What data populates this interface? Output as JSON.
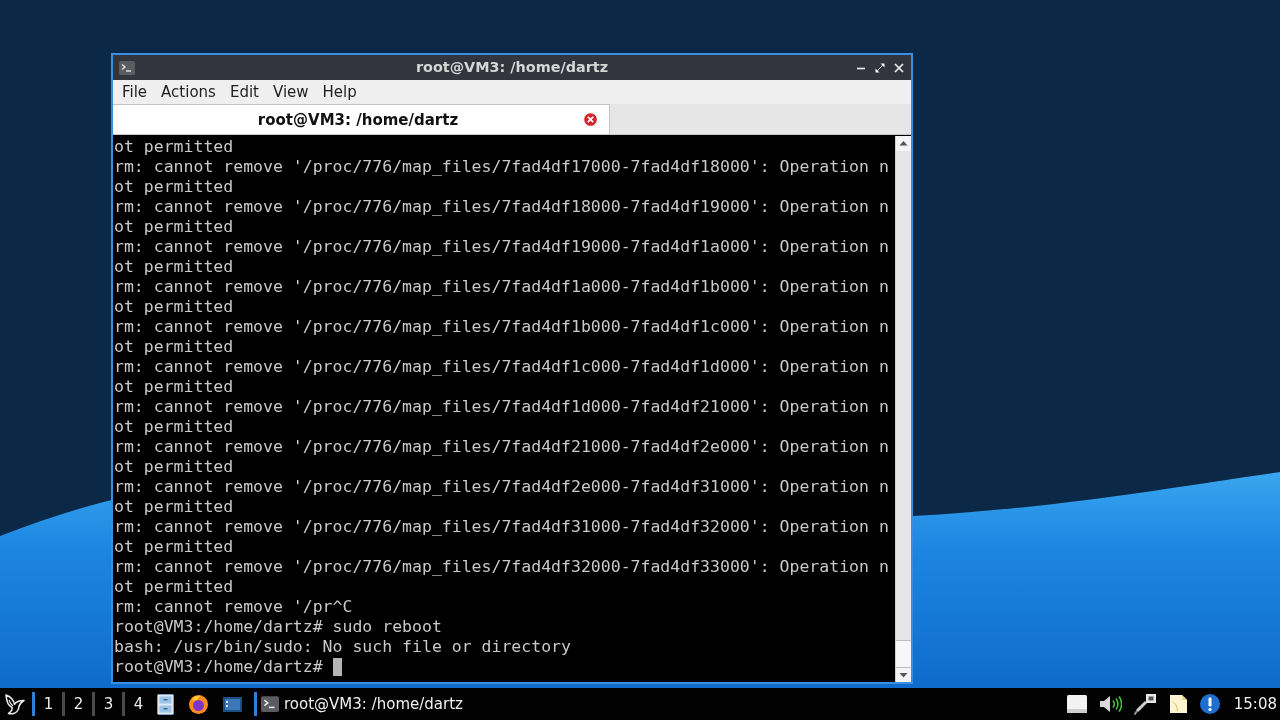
{
  "window": {
    "title": "root@VM3: /home/dartz"
  },
  "menu": [
    "File",
    "Actions",
    "Edit",
    "View",
    "Help"
  ],
  "tabs": [
    {
      "label": "root@VM3: /home/dartz",
      "selected": true
    }
  ],
  "terminal": {
    "lines": [
      "ot permitted",
      "rm: cannot remove '/proc/776/map_files/7fad4df17000-7fad4df18000': Operation n",
      "ot permitted",
      "rm: cannot remove '/proc/776/map_files/7fad4df18000-7fad4df19000': Operation n",
      "ot permitted",
      "rm: cannot remove '/proc/776/map_files/7fad4df19000-7fad4df1a000': Operation n",
      "ot permitted",
      "rm: cannot remove '/proc/776/map_files/7fad4df1a000-7fad4df1b000': Operation n",
      "ot permitted",
      "rm: cannot remove '/proc/776/map_files/7fad4df1b000-7fad4df1c000': Operation n",
      "ot permitted",
      "rm: cannot remove '/proc/776/map_files/7fad4df1c000-7fad4df1d000': Operation n",
      "ot permitted",
      "rm: cannot remove '/proc/776/map_files/7fad4df1d000-7fad4df21000': Operation n",
      "ot permitted",
      "rm: cannot remove '/proc/776/map_files/7fad4df21000-7fad4df2e000': Operation n",
      "ot permitted",
      "rm: cannot remove '/proc/776/map_files/7fad4df2e000-7fad4df31000': Operation n",
      "ot permitted",
      "rm: cannot remove '/proc/776/map_files/7fad4df31000-7fad4df32000': Operation n",
      "ot permitted",
      "rm: cannot remove '/proc/776/map_files/7fad4df32000-7fad4df33000': Operation n",
      "ot permitted",
      "rm: cannot remove '/pr^C",
      "root@VM3:/home/dartz# sudo reboot",
      "bash: /usr/bin/sudo: No such file or directory",
      "root@VM3:/home/dartz#"
    ],
    "cursor": true
  },
  "taskbar": {
    "workspaces": [
      "1",
      "2",
      "3",
      "4"
    ],
    "tasks": [
      {
        "label": "root@VM3: /home/dartz"
      }
    ],
    "clock": "15:08"
  }
}
